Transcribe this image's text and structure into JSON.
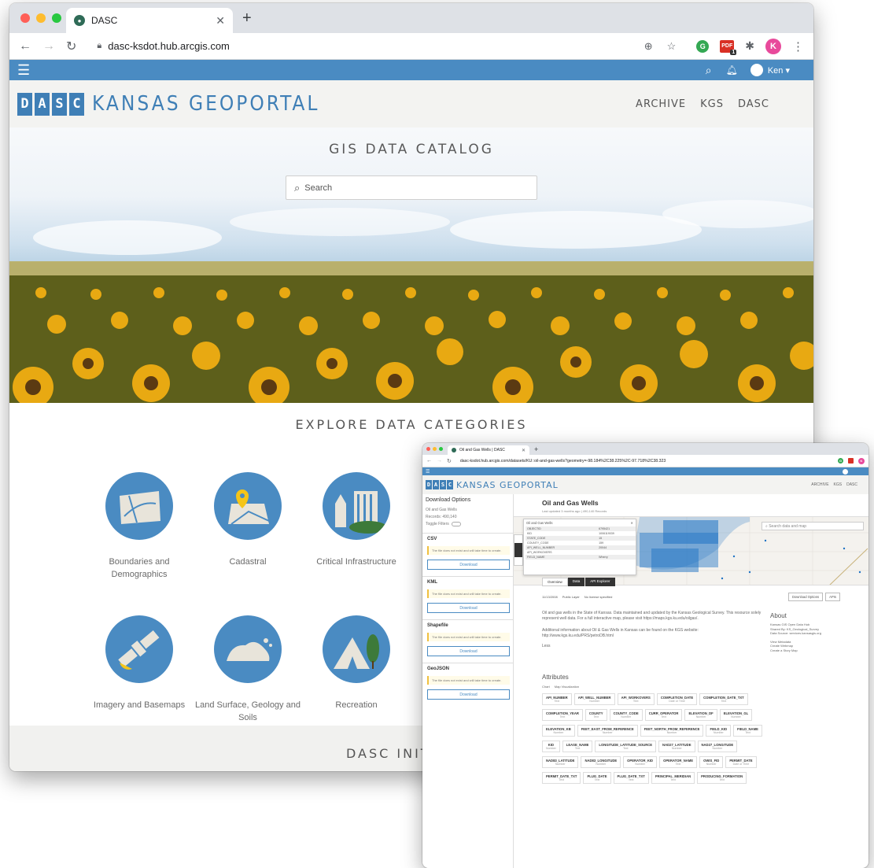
{
  "main_window": {
    "tab_title": "DASC",
    "url": "dasc-ksdot.hub.arcgis.com",
    "profile_initial": "K",
    "ext_badge": "1",
    "user": "Ken",
    "brand": {
      "logo_letters": [
        "D",
        "A",
        "S",
        "C"
      ],
      "name": "KANSAS GEOPORTAL"
    },
    "nav": [
      "ARCHIVE",
      "KGS",
      "DASC"
    ],
    "hero": {
      "title": "GIS DATA CATALOG",
      "search_placeholder": "Search"
    },
    "categories_title": "EXPLORE DATA CATEGORIES",
    "categories": [
      {
        "label": "Boundaries and Demographics",
        "icon": "map-boundaries-icon"
      },
      {
        "label": "Cadastral",
        "icon": "map-pin-icon"
      },
      {
        "label": "Critical Infrastructure",
        "icon": "buildings-icon"
      },
      {
        "label": "Imagery and Basemaps",
        "icon": "satellite-icon"
      },
      {
        "label": "Land Surface, Geology and Soils",
        "icon": "rocks-icon"
      },
      {
        "label": "Recreation",
        "icon": "tent-icon"
      }
    ],
    "footer_title": "DASC INITI"
  },
  "detail_window": {
    "tab_title": "Oil and Gas Wells | DASC",
    "url": "dasc-ksdot.hub.arcgis.com/datasets/KU::oil-and-gas-wells?geometry=-98.184%2C38.225%2C-97.718%2C38.323",
    "brand_name": "KANSAS GEOPORTAL",
    "nav": [
      "ARCHIVE",
      "KGS",
      "DASC"
    ],
    "sidebar": {
      "title": "Download Options",
      "dataset": "Oil and Gas Wells",
      "records": "Records: 490,140",
      "toggle_label": "Toggle Filters",
      "formats": [
        {
          "name": "CSV",
          "note": "The file does not exist and will take time to create.",
          "button": "Download"
        },
        {
          "name": "KML",
          "note": "The file does not exist and will take time to create.",
          "button": "Download"
        },
        {
          "name": "Shapefile",
          "note": "The file does not exist and will take time to create.",
          "button": "Download"
        },
        {
          "name": "GeoJSON",
          "note": "The file does not exist and will take time to create.",
          "button": "Download"
        }
      ]
    },
    "title": "Oil and Gas Wells",
    "subtitle": "Last updated 3 months ago | 490,140 Records",
    "map_search_placeholder": "Search data and map",
    "popup": {
      "title": "Oil and Gas Wells",
      "rows": [
        [
          "OBJECTID",
          "6795421"
        ],
        [
          "KID",
          "1006119039"
        ],
        [
          "STATE_CODE",
          "15"
        ],
        [
          "COUNTY_CODE",
          "159"
        ],
        [
          "API_WELL_NUMBER",
          "20044"
        ],
        [
          "API_WORKOVERS",
          ""
        ],
        [
          "FIELD_NAME",
          "Wherry"
        ]
      ]
    },
    "tabs": [
      "Overview",
      "Data",
      "API Explorer"
    ],
    "meta": [
      "11/13/2008",
      "Public Layer",
      "No license specified"
    ],
    "buttons": {
      "download": "Download Options",
      "apis": "APIs"
    },
    "description": "Oil and gas wells in the State of Kansas. Data maintained and updated by the Kansas Geological Survey. This resource solely represent well data. For a full interactive map, please visit https://maps.kgs.ku.edu/oilgas/.",
    "additional": "Additional information about Oil & Gas Wells in Kansas can be found on the KGS website: http://www.kgs.ku.edu/PRS/petroDB.html",
    "less": "Less",
    "about": {
      "title": "About",
      "lines": [
        "Kansas GIS Open Data Hub",
        "Shared By: KS_Geological_Survey",
        "Data Source: services.kansasgis.org"
      ],
      "links": [
        "View Metadata",
        "Create Webmap",
        "Create a Story Map"
      ]
    },
    "attributes": {
      "title": "Attributes",
      "toggles": [
        "Chart",
        "Map Visualization"
      ],
      "fields": [
        [
          "API_NUMBER",
          "Text"
        ],
        [
          "API_WELL_NUMBER",
          "Number"
        ],
        [
          "API_WORKOVERS",
          "Text"
        ],
        [
          "COMPLETION_DATE",
          "Date or Time"
        ],
        [
          "COMPLETION_DATE_TXT",
          "Text"
        ],
        [
          "COMPLETION_YEAR",
          "Text"
        ],
        [
          "COUNTY",
          "Text"
        ],
        [
          "COUNTY_CODE",
          "Number"
        ],
        [
          "CURR_OPERATOR",
          "Text"
        ],
        [
          "ELEVATION_DF",
          "Number"
        ],
        [
          "ELEVATION_GL",
          "Number"
        ],
        [
          "ELEVATION_KB",
          "Number"
        ],
        [
          "FEET_EAST_FROM_REFERENCE",
          "Number"
        ],
        [
          "FEET_NORTH_FROM_REFERENCE",
          "Number"
        ],
        [
          "FIELD_KID",
          "Number"
        ],
        [
          "FIELD_NAME",
          "Text"
        ],
        [
          "KID",
          "Number"
        ],
        [
          "LEASE_NAME",
          "Text"
        ],
        [
          "LONGITUDE_LATITUDE_SOURCE",
          "Text"
        ],
        [
          "NAD27_LATITUDE",
          "Number"
        ],
        [
          "NAD27_LONGITUDE",
          "Number"
        ],
        [
          "NAD83_LATITUDE",
          "Number"
        ],
        [
          "NAD83_LONGITUDE",
          "Number"
        ],
        [
          "OPERATOR_KID",
          "Number"
        ],
        [
          "OPERATOR_NAME",
          "Text"
        ],
        [
          "OWIS_FID",
          "Number"
        ],
        [
          "PERMIT_DATE",
          "Date or Time"
        ],
        [
          "PERMIT_DATE_TXT",
          "Text"
        ],
        [
          "PLUG_DATE",
          "Text"
        ],
        [
          "PLUG_DATE_TXT",
          "Text"
        ],
        [
          "PRINCIPAL_MERIDIAN",
          "Text"
        ],
        [
          "PRODUCING_FORMATION",
          "Text"
        ]
      ]
    }
  },
  "colors": {
    "brand_blue": "#4a8bc2",
    "chrome": "#dee1e6",
    "header_bg": "#f3f3f1"
  }
}
